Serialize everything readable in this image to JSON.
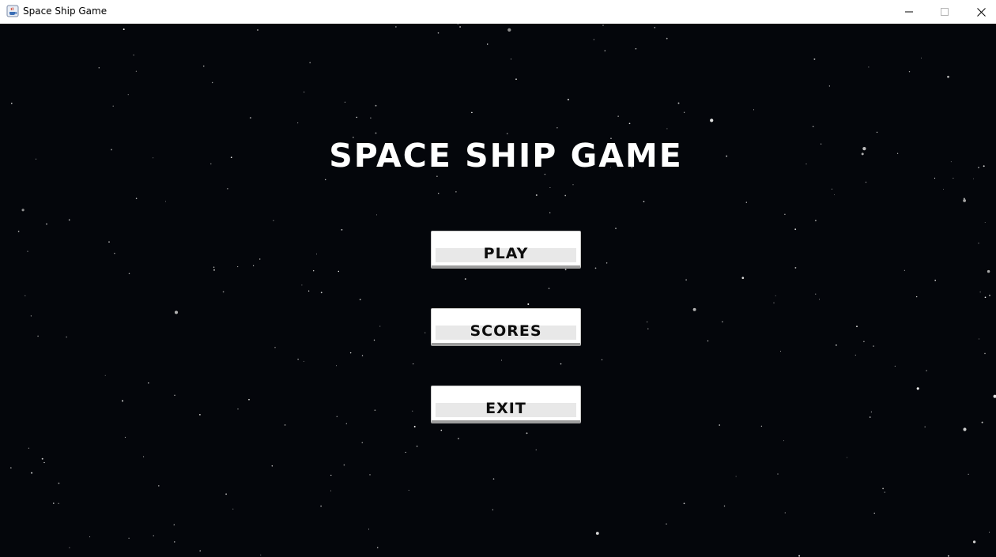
{
  "window": {
    "title": "Space Ship Game",
    "app_icon": "java-cup-icon",
    "controls": [
      "minimize-icon",
      "maximize-icon",
      "close-icon"
    ]
  },
  "game": {
    "title": "SPACE SHIP GAME",
    "background_color": "#04060b",
    "buttons": {
      "play": "PLAY",
      "scores": "SCORES",
      "exit": "EXIT"
    }
  }
}
